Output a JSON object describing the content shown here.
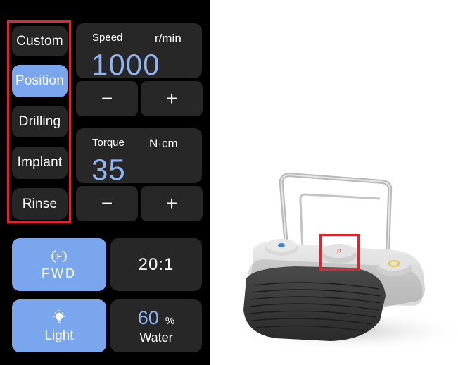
{
  "colors": {
    "panel_bg": "#000000",
    "card_bg": "#272727",
    "accent_blue": "#7aa6ee",
    "value_blue": "#8fb5f3",
    "highlight_red": "#e0262b"
  },
  "modes": {
    "items": [
      {
        "label": "Custom",
        "active": false
      },
      {
        "label": "Position",
        "active": true
      },
      {
        "label": "Drilling",
        "active": false
      },
      {
        "label": "Implant",
        "active": false
      },
      {
        "label": "Rinse",
        "active": false
      }
    ]
  },
  "speed": {
    "label": "Speed",
    "unit": "r/min",
    "value": "1000",
    "decrease": "−",
    "increase": "+"
  },
  "torque": {
    "label": "Torque",
    "unit": "N·cm",
    "value": "35",
    "decrease": "−",
    "increase": "+"
  },
  "direction": {
    "icon_letter": "F",
    "label": "FWD",
    "icon": "direction-f-icon"
  },
  "ratio": {
    "value": "20:1"
  },
  "light": {
    "label": "Light",
    "icon": "light-bulb-icon"
  },
  "water": {
    "value": "60",
    "unit": "%",
    "label": "Water"
  },
  "foot_pedal": {
    "center_button_letter": "P",
    "icon": "foot-pedal-image"
  }
}
